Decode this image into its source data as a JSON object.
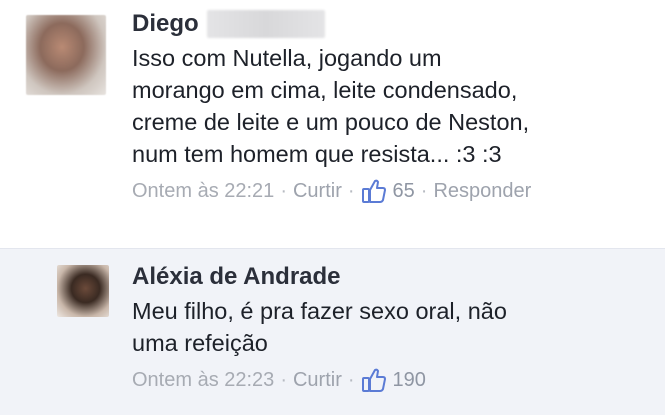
{
  "comments": [
    {
      "author": "Diego",
      "text": "Isso com Nutella, jogando um\nmorango em cima, leite condensado,\ncreme de leite e um pouco de Neston,\nnum tem homem que resista... :3 :3",
      "timestamp": "Ontem às 22:21",
      "like_label": "Curtir",
      "like_count": "65",
      "reply_label": "Responder"
    },
    {
      "author": "Aléxia de Andrade",
      "text": "Meu filho, é pra fazer sexo oral, não\numa refeição",
      "timestamp": "Ontem às 22:23",
      "like_label": "Curtir",
      "like_count": "190"
    }
  ],
  "colors": {
    "link": "#9ea3ad",
    "highlight_bg": "#f1f3f8",
    "like_icon": "#5b7bd5"
  },
  "icons": {
    "like": "thumbs-up-icon"
  }
}
